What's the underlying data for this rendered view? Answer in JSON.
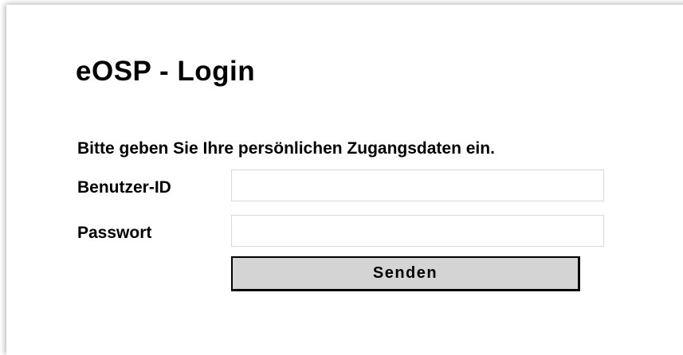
{
  "login": {
    "title": "eOSP - Login",
    "instruction": "Bitte geben Sie Ihre persönlichen Zugangsdaten ein.",
    "user_id": {
      "label": "Benutzer-ID",
      "value": "",
      "placeholder": ""
    },
    "password": {
      "label": "Passwort",
      "value": "",
      "placeholder": ""
    },
    "submit_label": "Senden"
  },
  "colors": {
    "background": "#ffffff",
    "text": "#000000",
    "button_face": "#d4d4d4",
    "field_border": "#d9d9d9"
  }
}
